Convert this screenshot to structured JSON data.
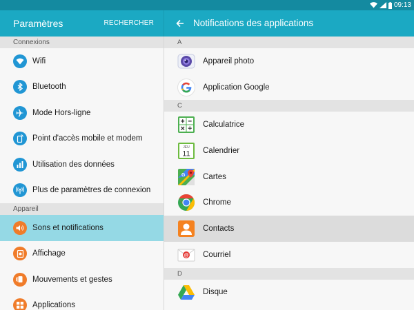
{
  "status_bar": {
    "time": "09:13"
  },
  "header": {
    "app_title": "Paramètres",
    "search_label": "RECHERCHER",
    "page_title": "Notifications des applications"
  },
  "left_panel": {
    "sections": [
      {
        "title": "Connexions",
        "items": [
          {
            "label": "Wifi",
            "icon": "wifi-icon",
            "color": "#2196d4"
          },
          {
            "label": "Bluetooth",
            "icon": "bluetooth-icon",
            "color": "#2196d4"
          },
          {
            "label": "Mode Hors-ligne",
            "icon": "airplane-icon",
            "color": "#2196d4"
          },
          {
            "label": "Point d'accès mobile et modem",
            "icon": "hotspot-icon",
            "color": "#2196d4"
          },
          {
            "label": "Utilisation des données",
            "icon": "data-usage-icon",
            "color": "#2196d4"
          },
          {
            "label": "Plus de paramètres de connexion",
            "icon": "more-connections-icon",
            "color": "#2196d4"
          }
        ]
      },
      {
        "title": "Appareil",
        "items": [
          {
            "label": "Sons et notifications",
            "icon": "sound-icon",
            "color": "#f07c2a",
            "active": true
          },
          {
            "label": "Affichage",
            "icon": "display-icon",
            "color": "#f07c2a"
          },
          {
            "label": "Mouvements et gestes",
            "icon": "motion-icon",
            "color": "#f07c2a"
          },
          {
            "label": "Applications",
            "icon": "apps-icon",
            "color": "#f07c2a"
          }
        ]
      }
    ]
  },
  "right_panel": {
    "groups": [
      {
        "letter": "A",
        "apps": [
          {
            "label": "Appareil photo",
            "icon": "camera-icon"
          },
          {
            "label": "Application Google",
            "icon": "google-icon"
          }
        ]
      },
      {
        "letter": "C",
        "apps": [
          {
            "label": "Calculatrice",
            "icon": "calculator-icon"
          },
          {
            "label": "Calendrier",
            "icon": "calendar-icon",
            "calendar_day": "JEU",
            "calendar_date": "11"
          },
          {
            "label": "Cartes",
            "icon": "maps-icon"
          },
          {
            "label": "Chrome",
            "icon": "chrome-icon"
          },
          {
            "label": "Contacts",
            "icon": "contacts-icon",
            "highlight": true
          },
          {
            "label": "Courriel",
            "icon": "email-icon"
          }
        ]
      },
      {
        "letter": "D",
        "apps": [
          {
            "label": "Disque",
            "icon": "drive-icon"
          }
        ]
      }
    ]
  },
  "colors": {
    "header": "#1ba9c3",
    "status_bar": "#148aa0",
    "active_row": "#95d9e5",
    "highlight_row": "#dcdcdc"
  }
}
